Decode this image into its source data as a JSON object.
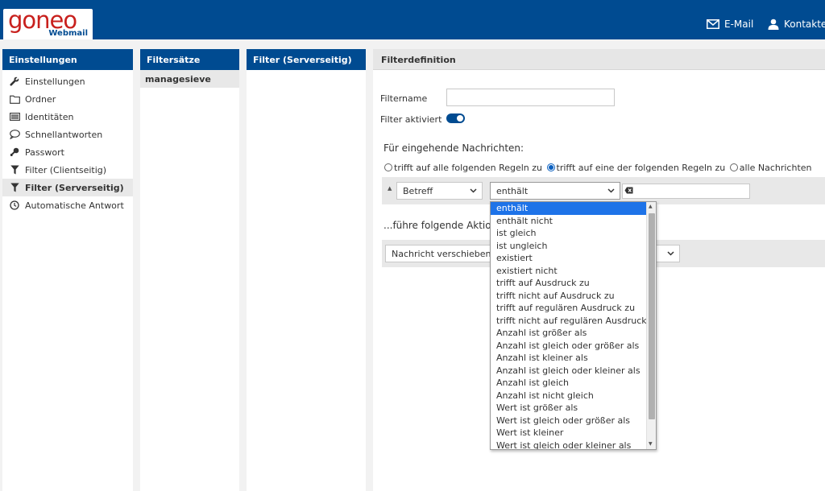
{
  "brand": {
    "name": "goneo",
    "sub": "Webmail"
  },
  "topnav": {
    "mail": "E-Mail",
    "contacts": "Kontakte"
  },
  "settings": {
    "header": "Einstellungen",
    "items": [
      {
        "label": "Einstellungen",
        "icon": "wrench-icon"
      },
      {
        "label": "Ordner",
        "icon": "folder-icon"
      },
      {
        "label": "Identitäten",
        "icon": "id-card-icon"
      },
      {
        "label": "Schnellantworten",
        "icon": "speech-bubble-icon"
      },
      {
        "label": "Passwort",
        "icon": "key-icon"
      },
      {
        "label": "Filter (Clientseitig)",
        "icon": "funnel-icon"
      },
      {
        "label": "Filter (Serverseitig)",
        "icon": "funnel-icon"
      },
      {
        "label": "Automatische Antwort",
        "icon": "clock-icon"
      }
    ]
  },
  "filtersets": {
    "header": "Filtersätze",
    "items": [
      "managesieve"
    ]
  },
  "serverfilter": {
    "header": "Filter (Serverseitig)"
  },
  "definition": {
    "header": "Filterdefinition",
    "filtername_label": "Filtername",
    "filtername_value": "",
    "active_label": "Filter aktiviert",
    "incoming_label": "Für eingehende Nachrichten:",
    "radio_all": "trifft auf alle folgenden Regeln zu",
    "radio_any": "trifft auf eine der folgenden Regeln zu",
    "radio_all_msgs": "alle Nachrichten",
    "rule_field": "Betreff",
    "rule_op": "enthält",
    "rule_value": "",
    "actions_label": "...führe folgende Aktionen",
    "action_value": "Nachricht verschieben nach"
  },
  "dropdown": {
    "selected": "enthält",
    "options": [
      "enthält",
      "enthält nicht",
      "ist gleich",
      "ist ungleich",
      "existiert",
      "existiert nicht",
      "trifft auf Ausdruck zu",
      "trifft nicht auf Ausdruck zu",
      "trifft auf regulären Ausdruck zu",
      "trifft nicht auf regulären Ausdruck zu",
      "Anzahl ist größer als",
      "Anzahl ist gleich oder größer als",
      "Anzahl ist kleiner als",
      "Anzahl ist gleich oder kleiner als",
      "Anzahl ist gleich",
      "Anzahl ist nicht gleich",
      "Wert ist größer als",
      "Wert ist gleich oder größer als",
      "Wert ist kleiner",
      "Wert ist gleich oder kleiner als"
    ]
  },
  "colors": {
    "brand_blue": "#004b91",
    "brand_red": "#c8201d",
    "highlight": "#1e73e8"
  }
}
